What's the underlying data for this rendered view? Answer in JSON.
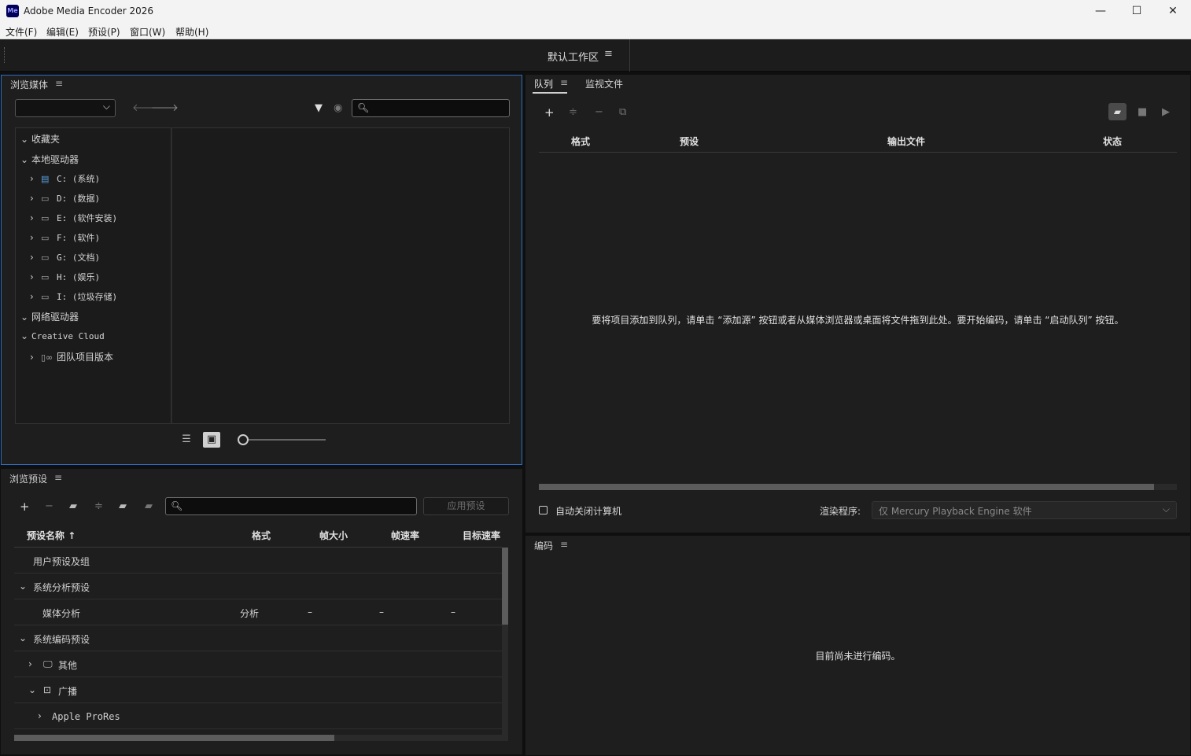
{
  "titlebar": {
    "logo": "Me",
    "title": "Adobe Media Encoder 2026",
    "minimize": "—",
    "maximize": "☐",
    "close": "✕"
  },
  "menu": {
    "file": "文件(F)",
    "edit": "编辑(E)",
    "preset": "预设(P)",
    "window": "窗口(W)",
    "help": "帮助(H)"
  },
  "workspace": {
    "label": "默认工作区",
    "menu_icon": "≡"
  },
  "media_browser": {
    "tab": "浏览媒体",
    "menu_icon": "≡",
    "dropdown_value": "",
    "search_placeholder": "",
    "tree": [
      {
        "label": "收藏夹",
        "expanded": true
      },
      {
        "label": "本地驱动器",
        "expanded": true
      },
      {
        "label": "C: (系统)",
        "icon": "drive-icon"
      },
      {
        "label": "D: (数据)",
        "icon": "drive-icon"
      },
      {
        "label": "E: (软件安装)",
        "icon": "drive-icon"
      },
      {
        "label": "F: (软件)",
        "icon": "drive-icon"
      },
      {
        "label": "G: (文档)",
        "icon": "drive-icon"
      },
      {
        "label": "H: (娱乐)",
        "icon": "drive-icon"
      },
      {
        "label": "I: (垃圾存储)",
        "icon": "drive-icon"
      },
      {
        "label": "网络驱动器",
        "expanded": true
      },
      {
        "label": "Creative Cloud",
        "expanded": true
      },
      {
        "label": "团队项目版本",
        "icon": "team-project-icon"
      }
    ]
  },
  "preset_browser": {
    "tab": "浏览预设",
    "menu_icon": "≡",
    "apply_button": "应用预设",
    "search_placeholder": "",
    "columns": {
      "name": "预设名称",
      "format": "格式",
      "frame_size": "帧大小",
      "frame_rate": "帧速率",
      "target_rate": "目标速率"
    },
    "rows": [
      {
        "name": "用户预设及组",
        "format": "",
        "frame_size": "",
        "frame_rate": "",
        "target_rate": ""
      },
      {
        "name": "系统分析预设",
        "format": "",
        "frame_size": "",
        "frame_rate": "",
        "target_rate": ""
      },
      {
        "name": "媒体分析",
        "format": "分析",
        "frame_size": "–",
        "frame_rate": "–",
        "target_rate": "–"
      },
      {
        "name": "系统编码预设",
        "format": "",
        "frame_size": "",
        "frame_rate": "",
        "target_rate": ""
      },
      {
        "name": "其他",
        "format": "",
        "frame_size": "",
        "frame_rate": "",
        "target_rate": ""
      },
      {
        "name": "广播",
        "format": "",
        "frame_size": "",
        "frame_rate": "",
        "target_rate": ""
      },
      {
        "name": "Apple ProRes",
        "format": "",
        "frame_size": "",
        "frame_rate": "",
        "target_rate": ""
      }
    ]
  },
  "queue": {
    "tab_queue": "队列",
    "tab_watch": "监视文件",
    "menu_icon": "≡",
    "columns": {
      "format": "格式",
      "preset": "预设",
      "output": "输出文件",
      "status": "状态"
    },
    "empty_message": "要将项目添加到队列，请单击 “添加源” 按钮或者从媒体浏览器或桌面将文件拖到此处。要开始编码，请单击 “启动队列” 按钮。",
    "auto_shutdown": "自动关闭计算机",
    "renderer_label": "渲染程序:",
    "renderer_value": "仅 Mercury Playback Engine 软件"
  },
  "encoding": {
    "tab": "编码",
    "menu_icon": "≡",
    "message": "目前尚未进行编码。"
  }
}
